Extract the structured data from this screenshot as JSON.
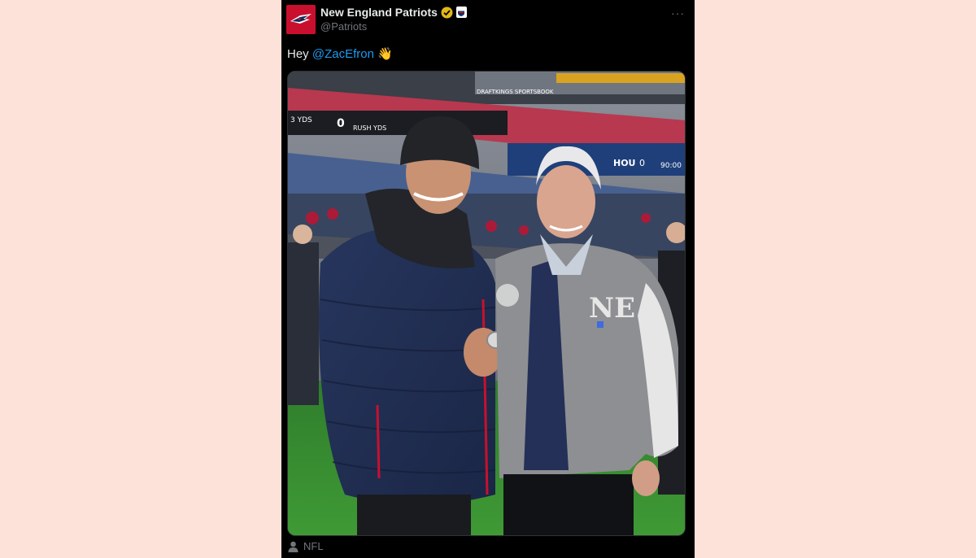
{
  "account": {
    "display_name": "New England Patriots",
    "handle": "@Patriots",
    "avatar_icon": "patriots-logo-icon",
    "verified_icon": "verified-badge-icon",
    "affiliation_icon": "nfl-shield-icon"
  },
  "post": {
    "text_prefix": "Hey ",
    "mention": "@ZacEfron",
    "emoji": "👋",
    "more_label": "···"
  },
  "media": {
    "scoreboard_left": "3 YDS",
    "scoreboard_score": "0",
    "scoreboard_rush": "RUSH YDS",
    "scoreboard_hou": "HOU",
    "scoreboard_hou_score": "0",
    "scoreboard_time": "90:00",
    "sponsor": "DRAFTKINGS SPORTSBOOK",
    "jacket_letters": "NE"
  },
  "footer": {
    "icon": "person-icon",
    "label": "NFL"
  },
  "colors": {
    "background": "#fde2d9",
    "card": "#000000",
    "link": "#1d9bf0",
    "muted": "#71767b",
    "patriots_red": "#c8102e"
  }
}
